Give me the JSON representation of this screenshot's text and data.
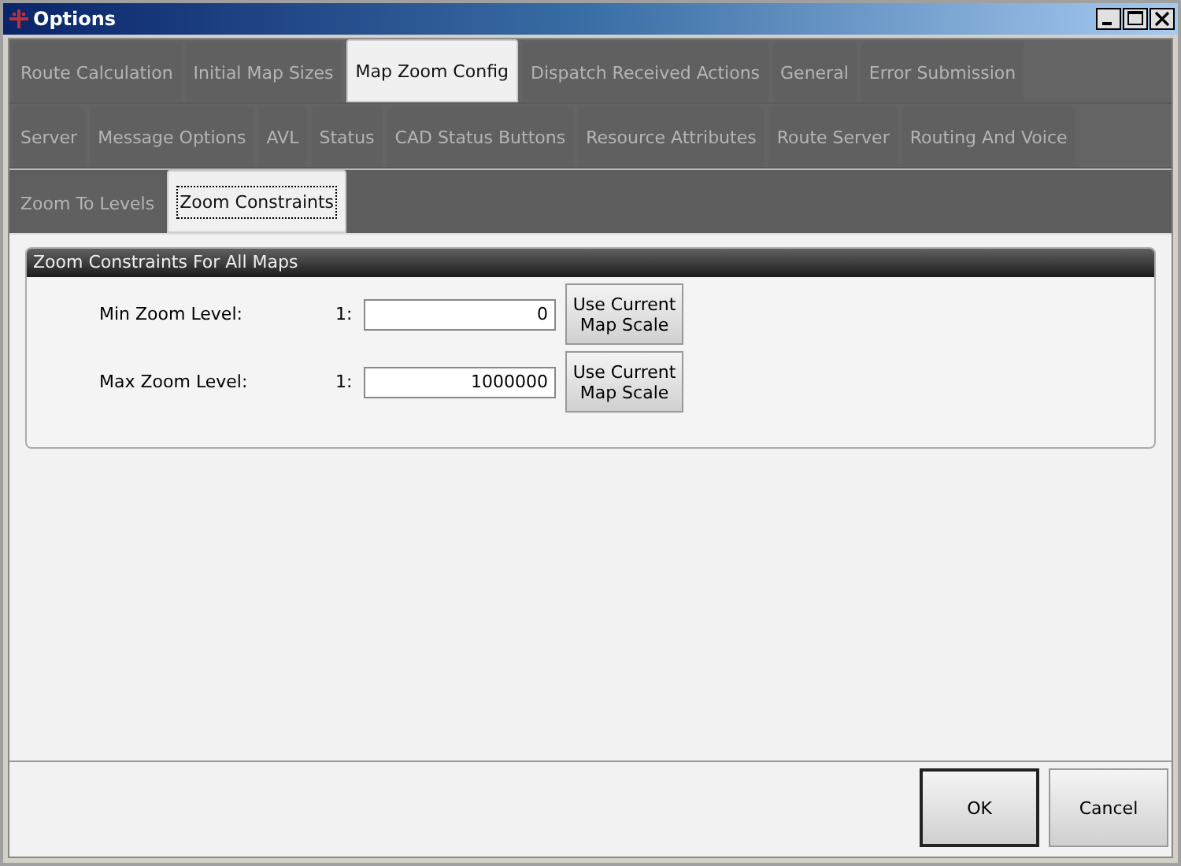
{
  "window": {
    "title": "Options"
  },
  "tab_rows": [
    [
      {
        "label": "Route Calculation",
        "selected": false
      },
      {
        "label": "Initial Map Sizes",
        "selected": false
      },
      {
        "label": "Map Zoom Config",
        "selected": true
      },
      {
        "label": "Dispatch Received Actions",
        "selected": false
      },
      {
        "label": "General",
        "selected": false
      },
      {
        "label": "Error Submission",
        "selected": false
      }
    ],
    [
      {
        "label": "Server",
        "selected": false
      },
      {
        "label": "Message Options",
        "selected": false
      },
      {
        "label": "AVL",
        "selected": false
      },
      {
        "label": "Status",
        "selected": false
      },
      {
        "label": "CAD Status Buttons",
        "selected": false
      },
      {
        "label": "Resource Attributes",
        "selected": false
      },
      {
        "label": "Route Server",
        "selected": false
      },
      {
        "label": "Routing And Voice",
        "selected": false
      }
    ]
  ],
  "subtabs": [
    {
      "label": "Zoom To Levels",
      "selected": false
    },
    {
      "label": "Zoom Constraints",
      "selected": true
    }
  ],
  "group": {
    "title": "Zoom Constraints For All Maps",
    "rows": [
      {
        "label": "Min Zoom Level:",
        "prefix": "1:",
        "value": "0",
        "button": "Use Current Map Scale"
      },
      {
        "label": "Max Zoom Level:",
        "prefix": "1:",
        "value": "1000000",
        "button": "Use Current Map Scale"
      }
    ]
  },
  "buttons": [
    "OK",
    "Cancel"
  ]
}
